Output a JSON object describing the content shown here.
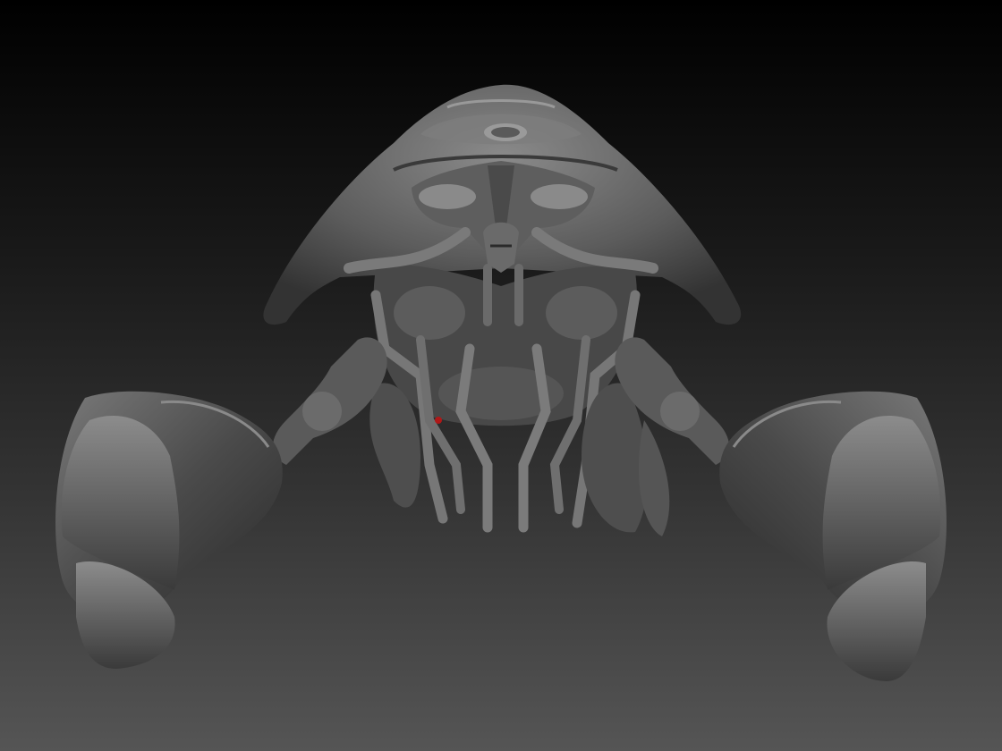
{
  "viewport": {
    "background_top": "#000000",
    "background_bottom": "#555555"
  },
  "model": {
    "material_base": "#6e6e6e",
    "material_highlight": "#9a9a9a",
    "material_shadow": "#2e2e2e",
    "accent_red": "#b01818"
  }
}
